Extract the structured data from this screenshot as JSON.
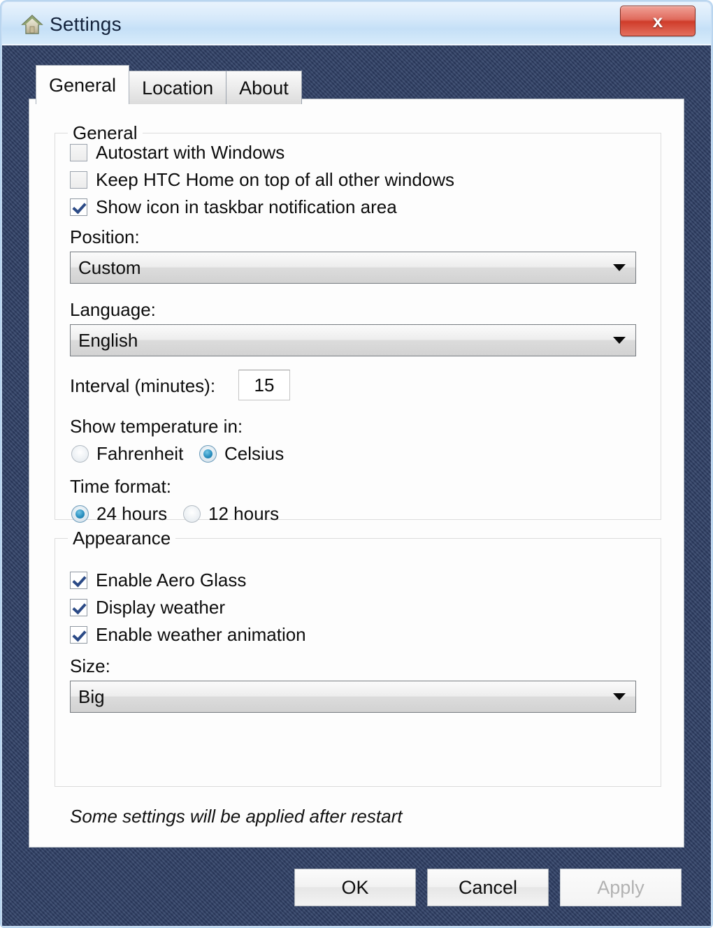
{
  "window": {
    "title": "Settings",
    "title_icon": "home-icon",
    "close_label": "x",
    "frame_color": "#2e3f66",
    "titlebar_color": "#c5e0f7",
    "close_button_color": "#cf3c2a"
  },
  "tabs": [
    {
      "label": "General",
      "active": true
    },
    {
      "label": "Location",
      "active": false
    },
    {
      "label": "About",
      "active": false
    }
  ],
  "general_group": {
    "legend": "General",
    "checkboxes": [
      {
        "label": "Autostart with Windows",
        "checked": false
      },
      {
        "label": "Keep HTC Home on top of all other windows",
        "checked": false
      },
      {
        "label": "Show icon in taskbar notification area",
        "checked": true
      }
    ],
    "position": {
      "label": "Position:",
      "value": "Custom"
    },
    "language": {
      "label": "Language:",
      "value": "English"
    },
    "interval": {
      "label": "Interval (minutes):",
      "value": "15"
    },
    "temperature": {
      "label": "Show temperature in:",
      "options": [
        {
          "label": "Fahrenheit",
          "selected": false
        },
        {
          "label": "Celsius",
          "selected": true
        }
      ]
    },
    "time_format": {
      "label": "Time format:",
      "options": [
        {
          "label": "24 hours",
          "selected": true
        },
        {
          "label": "12 hours",
          "selected": false
        }
      ]
    }
  },
  "appearance_group": {
    "legend": "Appearance",
    "checkboxes": [
      {
        "label": "Enable Aero Glass",
        "checked": true
      },
      {
        "label": "Display weather",
        "checked": true
      },
      {
        "label": "Enable weather animation",
        "checked": true
      }
    ],
    "size": {
      "label": "Size:",
      "value": "Big"
    }
  },
  "note": "Some settings will be applied after restart",
  "buttons": [
    {
      "label": "OK",
      "enabled": true
    },
    {
      "label": "Cancel",
      "enabled": true
    },
    {
      "label": "Apply",
      "enabled": false
    }
  ]
}
